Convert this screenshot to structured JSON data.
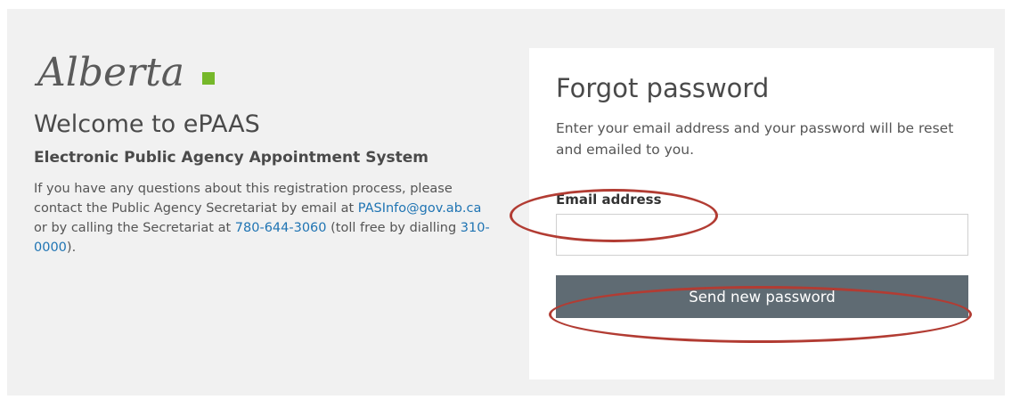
{
  "brand": {
    "logo_text": "Alberta",
    "accent_color": "#76b82a"
  },
  "left": {
    "welcome_title": "Welcome to ePAAS",
    "subtitle": "Electronic Public Agency Appointment System",
    "info_part1": "If you have any questions about this registration process, please contact the Public Agency Secretariat by email at ",
    "email_link": "PASInfo@gov.ab.ca",
    "info_part2": " or by calling the Secretariat at ",
    "phone_link": "780-644-3060",
    "info_part3": " (toll free by dialling ",
    "tollfree_link": "310-0000",
    "info_part4": ")."
  },
  "card": {
    "title": "Forgot password",
    "description": "Enter your email address and your password will be reset and emailed to you.",
    "email_label": "Email address",
    "email_value": "",
    "send_button": "Send new password"
  },
  "colors": {
    "button_bg": "#5f6b73",
    "link": "#1f74b3",
    "annotation": "#b23c33"
  }
}
